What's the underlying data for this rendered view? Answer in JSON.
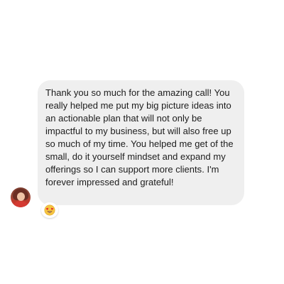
{
  "message": {
    "text": "Thank you so much for the amazing call! You really helped me put my big picture ideas into an actionable plan that will not only be impactful to my business, but will also free up so much of my time. You helped me get of the small, do it yourself mindset and expand my offerings so I can support more clients. I'm forever impressed and grateful!"
  },
  "sender": {
    "avatar_icon": "user-avatar"
  },
  "reaction": {
    "icon": "heart-eyes-emoji"
  },
  "colors": {
    "bubble": "#efefef",
    "text": "#1c1c1c",
    "background": "#ffffff"
  }
}
